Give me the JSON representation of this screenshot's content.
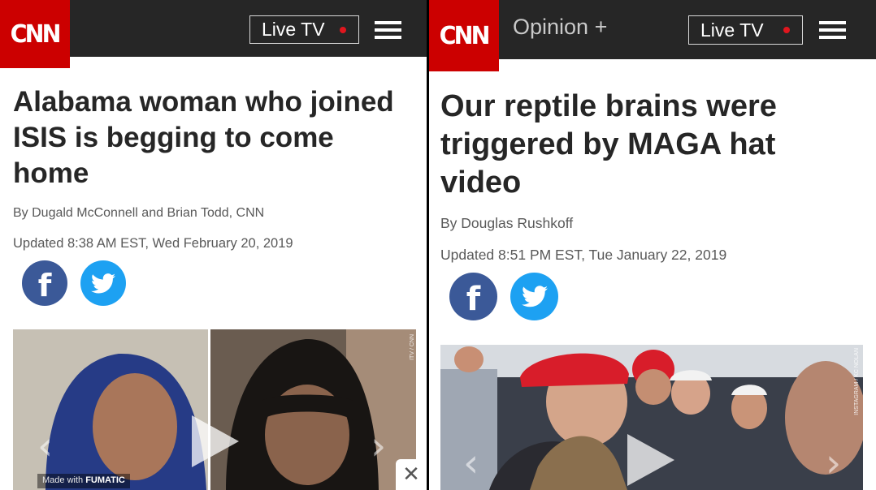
{
  "left": {
    "logo": "CNN",
    "live_tv_label": "Live TV",
    "headline": "Alabama woman who joined ISIS is begging to come home",
    "byline": "By Dugald McConnell and Brian Todd, CNN",
    "updated": "Updated 8:38 AM EST, Wed February 20, 2019",
    "video": {
      "made_with_prefix": "Made with",
      "made_with_brand": "FUMATIC"
    },
    "close_label": "✕"
  },
  "right": {
    "logo": "CNN",
    "section_label": "Opinion +",
    "live_tv_label": "Live TV",
    "headline": "Our reptile brains were triggered by MAGA hat video",
    "byline": "By Douglas Rushkoff",
    "updated": "Updated 8:51 PM EST, Tue January 22, 2019"
  },
  "colors": {
    "cnn_red": "#cc0000",
    "topbar": "#262626",
    "facebook": "#3b5998",
    "twitter": "#1da1f2",
    "live_dot": "#e0161e"
  },
  "icons": [
    "cnn-logo",
    "live-dot-icon",
    "hamburger-menu-icon",
    "facebook-icon",
    "twitter-icon",
    "play-icon",
    "chevron-left-icon",
    "chevron-right-icon",
    "close-icon"
  ]
}
